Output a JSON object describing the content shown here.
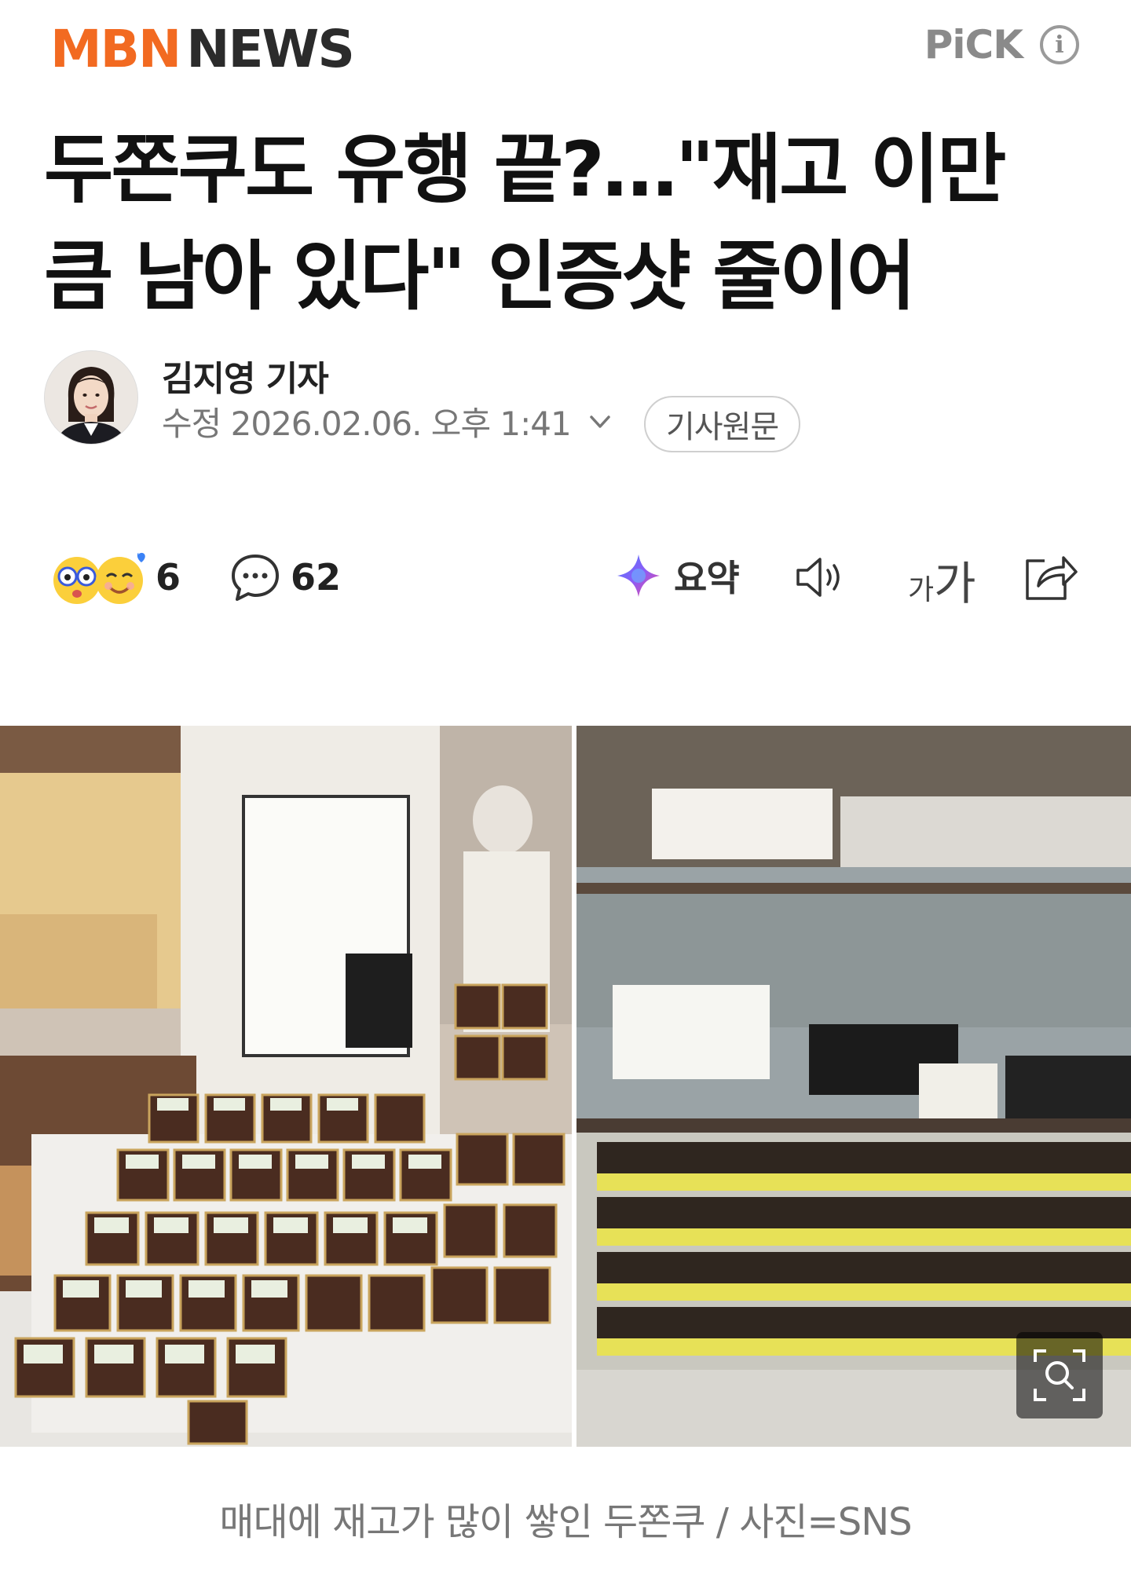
{
  "header": {
    "logo_part1": "MBN",
    "logo_part2": "NEWS",
    "pick_label": "PiCK",
    "info_glyph": "i"
  },
  "article": {
    "headline": "두쫀쿠도 유행 끝?…\"재고 이만큼 남아 있다\" 인증샷 줄이어",
    "author": "김지영 기자",
    "date": "수정 2026.02.06. 오후 1:41",
    "original_button": "기사원문"
  },
  "actions": {
    "reaction_count": "6",
    "comment_count": "62",
    "summary_label": "요약",
    "font_small": "가",
    "font_large": "가"
  },
  "image": {
    "caption": "매대에 재고가 많이 쌓인 두쫀쿠 / 사진=SNS"
  },
  "colors": {
    "brand": "#f26a21",
    "text_dark": "#111111",
    "muted": "#777777"
  },
  "icons": [
    "info-icon",
    "chevron-down-icon",
    "reaction-emoji-icon",
    "comment-icon",
    "ai-summary-icon",
    "speaker-icon",
    "font-size-icon",
    "share-icon",
    "zoom-icon"
  ]
}
